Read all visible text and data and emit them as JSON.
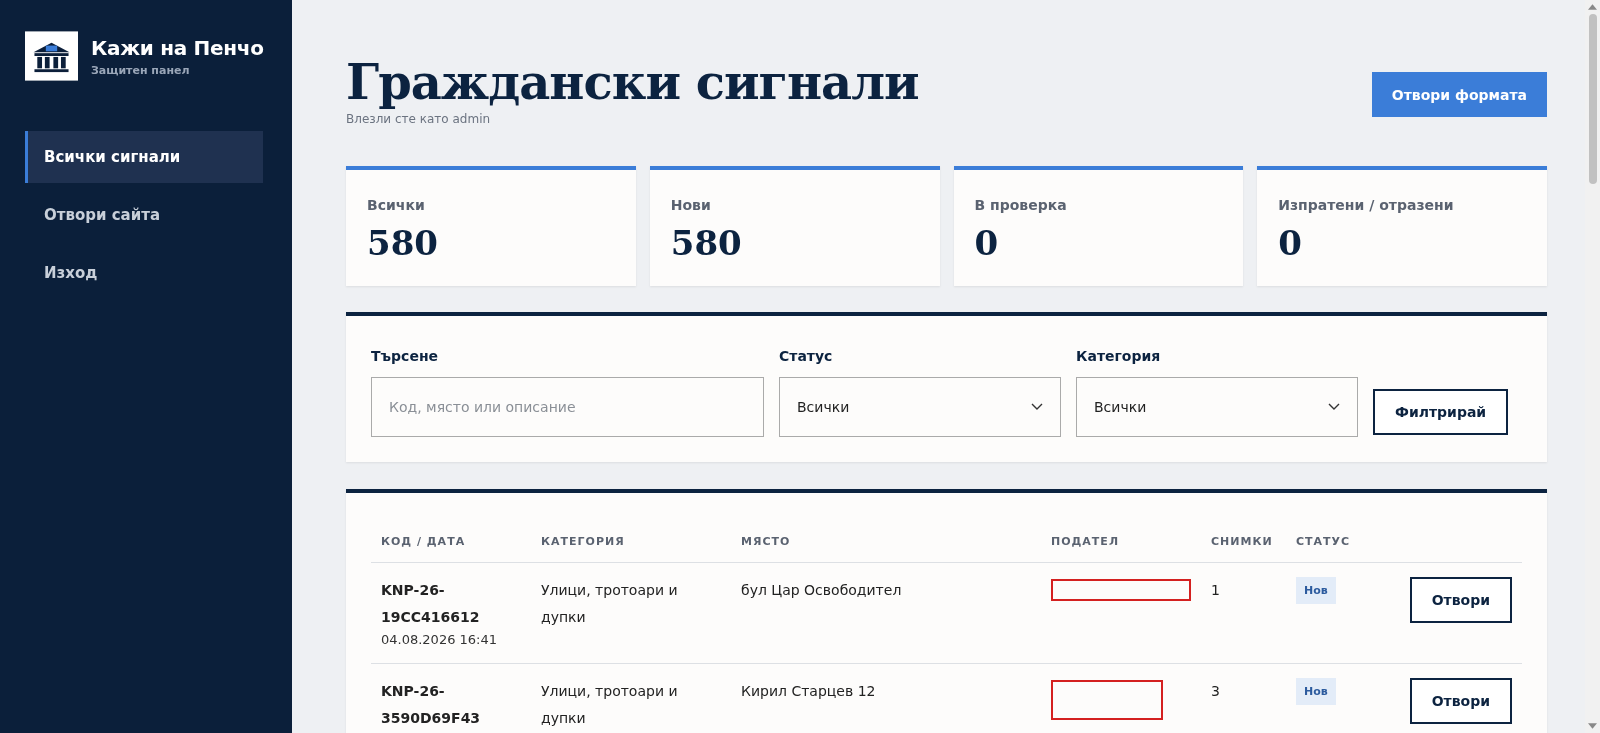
{
  "brand": {
    "title": "Кажи на Пенчо",
    "subtitle": "Защитен панел"
  },
  "nav": [
    {
      "label": "Всички сигнали",
      "selected": true
    },
    {
      "label": "Отвори сайта",
      "selected": false
    },
    {
      "label": "Изход",
      "selected": false
    }
  ],
  "header": {
    "title": "Граждански сигнали",
    "subtitle": "Влезли сте като admin",
    "button": "Отвори формата"
  },
  "stats": [
    {
      "label": "Всички",
      "value": "580"
    },
    {
      "label": "Нови",
      "value": "580"
    },
    {
      "label": "В проверка",
      "value": "0"
    },
    {
      "label": "Изпратени / отразени",
      "value": "0"
    }
  ],
  "filters": {
    "search": {
      "label": "Търсене",
      "placeholder": "Код, място или описание"
    },
    "status": {
      "label": "Статус",
      "value": "Всички"
    },
    "category": {
      "label": "Категория",
      "value": "Всички"
    },
    "button": "Филтрирай"
  },
  "table": {
    "columns": [
      "КОД / ДАТА",
      "КАТЕГОРИЯ",
      "МЯСТО",
      "ПОДАТЕЛ",
      "СНИМКИ",
      "СТАТУС"
    ],
    "rows": [
      {
        "code": "KNP-26-19CC416612",
        "date": "04.08.2026 16:41",
        "category": "Улици, тротоари и дупки",
        "place": "бул Цар Освободител",
        "photos": "1",
        "status": "Нов",
        "action": "Отвори"
      },
      {
        "code": "KNP-26-3590D69F43",
        "category": "Улици, тротоари и дупки",
        "place": "Кирил Старцев 12",
        "photos": "3",
        "status": "Нов",
        "action": "Отвори"
      }
    ]
  }
}
